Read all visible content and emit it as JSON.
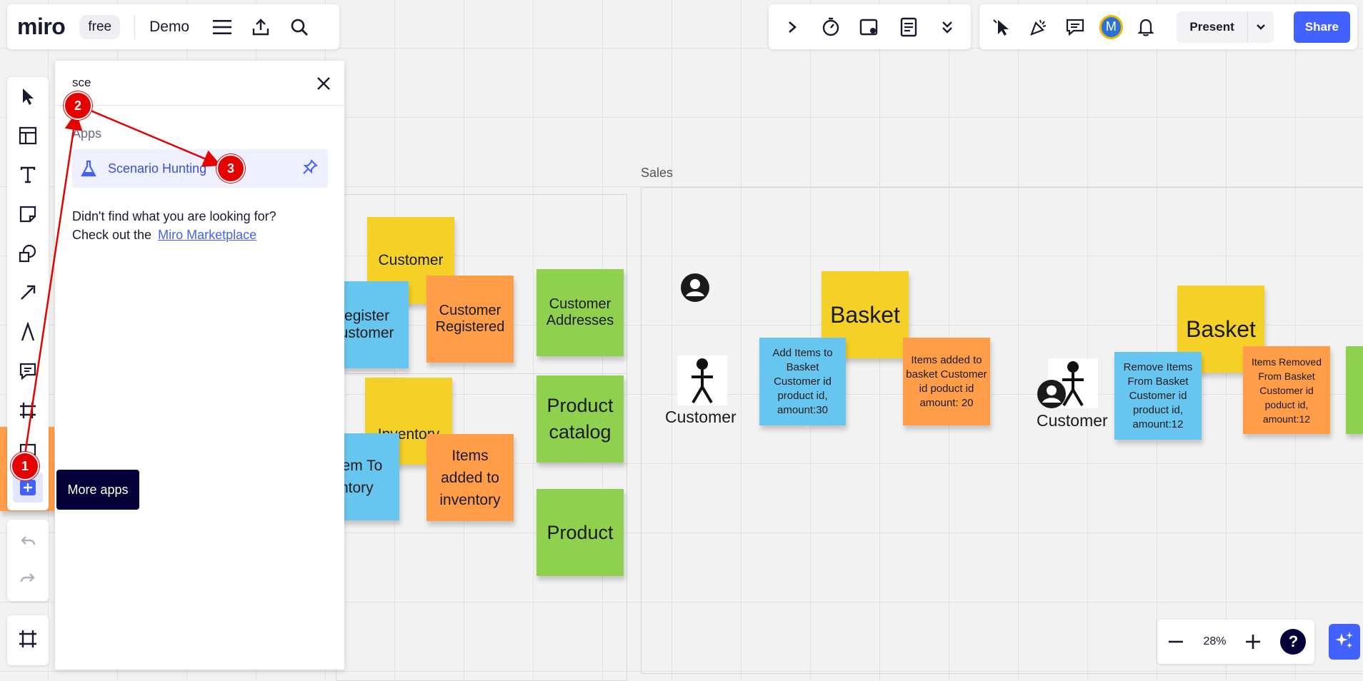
{
  "topbar": {
    "logo": "miro",
    "plan": "free",
    "board_name": "Demo"
  },
  "toolbar_right": {
    "avatar_initial": "M",
    "present_label": "Present",
    "share_label": "Share"
  },
  "apps_panel": {
    "search_value": "sce",
    "section_title": "Apps",
    "app_name": "Scenario Hunting",
    "not_found_line1": "Didn't find what you are looking for?",
    "not_found_line2": "Check out the",
    "marketplace_link": "Miro Marketplace"
  },
  "tooltip": "More apps",
  "canvas": {
    "frame_label": "Sales",
    "stickies": [
      {
        "text": "Customer"
      },
      {
        "text": "Register Customer"
      },
      {
        "text": "Customer Registered"
      },
      {
        "text": "Customer Addresses"
      },
      {
        "text": "Inventory"
      },
      {
        "text": "Add Item To Inventory"
      },
      {
        "text": "Items added to inventory"
      },
      {
        "text": "Product catalog"
      },
      {
        "text": "Product"
      },
      {
        "text": "Basket"
      },
      {
        "text": "Add Items to Basket Customer id product id, amount:30"
      },
      {
        "text": "Items added to basket Customer id poduct id amount: 20"
      },
      {
        "text": "Basket"
      },
      {
        "text": "Remove Items From Basket Customer id product id, amount:12"
      },
      {
        "text": "Items Removed From Basket Customer id poduct id, amount:12"
      }
    ],
    "person_labels": [
      "Customer",
      "Customer"
    ]
  },
  "zoom": {
    "level": "28%"
  },
  "markers": [
    "1",
    "2",
    "3"
  ],
  "colors": {
    "accent": "#4262ff",
    "marker": "#e60000",
    "sticky_yellow": "#f5d128",
    "sticky_orange": "#ff9d48",
    "sticky_blue": "#67c6f0",
    "sticky_green": "#8fd14f"
  }
}
